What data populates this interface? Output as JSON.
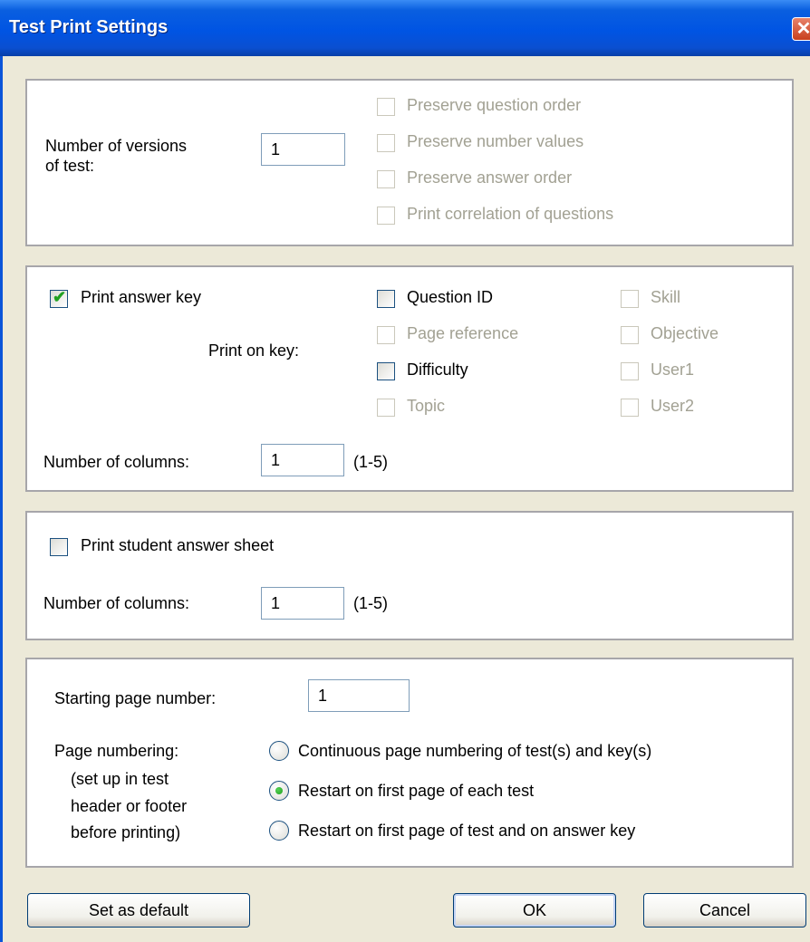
{
  "window": {
    "title": "Test Print Settings",
    "close_symbol": "✕"
  },
  "versions": {
    "label_line1": "Number of versions",
    "label_line2": "of test:",
    "value": "1",
    "options": [
      {
        "label": "Preserve question order",
        "checked": false,
        "enabled": false
      },
      {
        "label": "Preserve number values",
        "checked": false,
        "enabled": false
      },
      {
        "label": "Preserve answer order",
        "checked": false,
        "enabled": false
      },
      {
        "label": "Print correlation of questions",
        "checked": false,
        "enabled": false
      }
    ]
  },
  "answer_key": {
    "checkbox_label": "Print answer key",
    "checked": true,
    "print_on_key_label": "Print on key:",
    "fields_col1": [
      {
        "label": "Question ID",
        "checked": false,
        "enabled": true
      },
      {
        "label": "Page reference",
        "checked": false,
        "enabled": false
      },
      {
        "label": "Difficulty",
        "checked": false,
        "enabled": true
      },
      {
        "label": "Topic",
        "checked": false,
        "enabled": false
      }
    ],
    "fields_col2": [
      {
        "label": "Skill",
        "checked": false,
        "enabled": false
      },
      {
        "label": "Objective",
        "checked": false,
        "enabled": false
      },
      {
        "label": "User1",
        "checked": false,
        "enabled": false
      },
      {
        "label": "User2",
        "checked": false,
        "enabled": false
      }
    ],
    "columns_label": "Number of columns:",
    "columns_value": "1",
    "columns_range": "(1-5)"
  },
  "student_sheet": {
    "checkbox_label": "Print student answer sheet",
    "checked": false,
    "columns_label": "Number of columns:",
    "columns_value": "1",
    "columns_range": "(1-5)"
  },
  "page_numbering": {
    "starting_label": "Starting page number:",
    "starting_value": "1",
    "label": "Page numbering:",
    "note_line1": "(set up in test",
    "note_line2": "header or footer",
    "note_line3": "before printing)",
    "options": [
      {
        "label": "Continuous page numbering of test(s) and key(s)",
        "selected": false
      },
      {
        "label": "Restart on first page of each test",
        "selected": true
      },
      {
        "label": "Restart on first page of test and on answer key",
        "selected": false
      }
    ]
  },
  "buttons": {
    "set_default": "Set as default",
    "ok": "OK",
    "cancel": "Cancel"
  }
}
